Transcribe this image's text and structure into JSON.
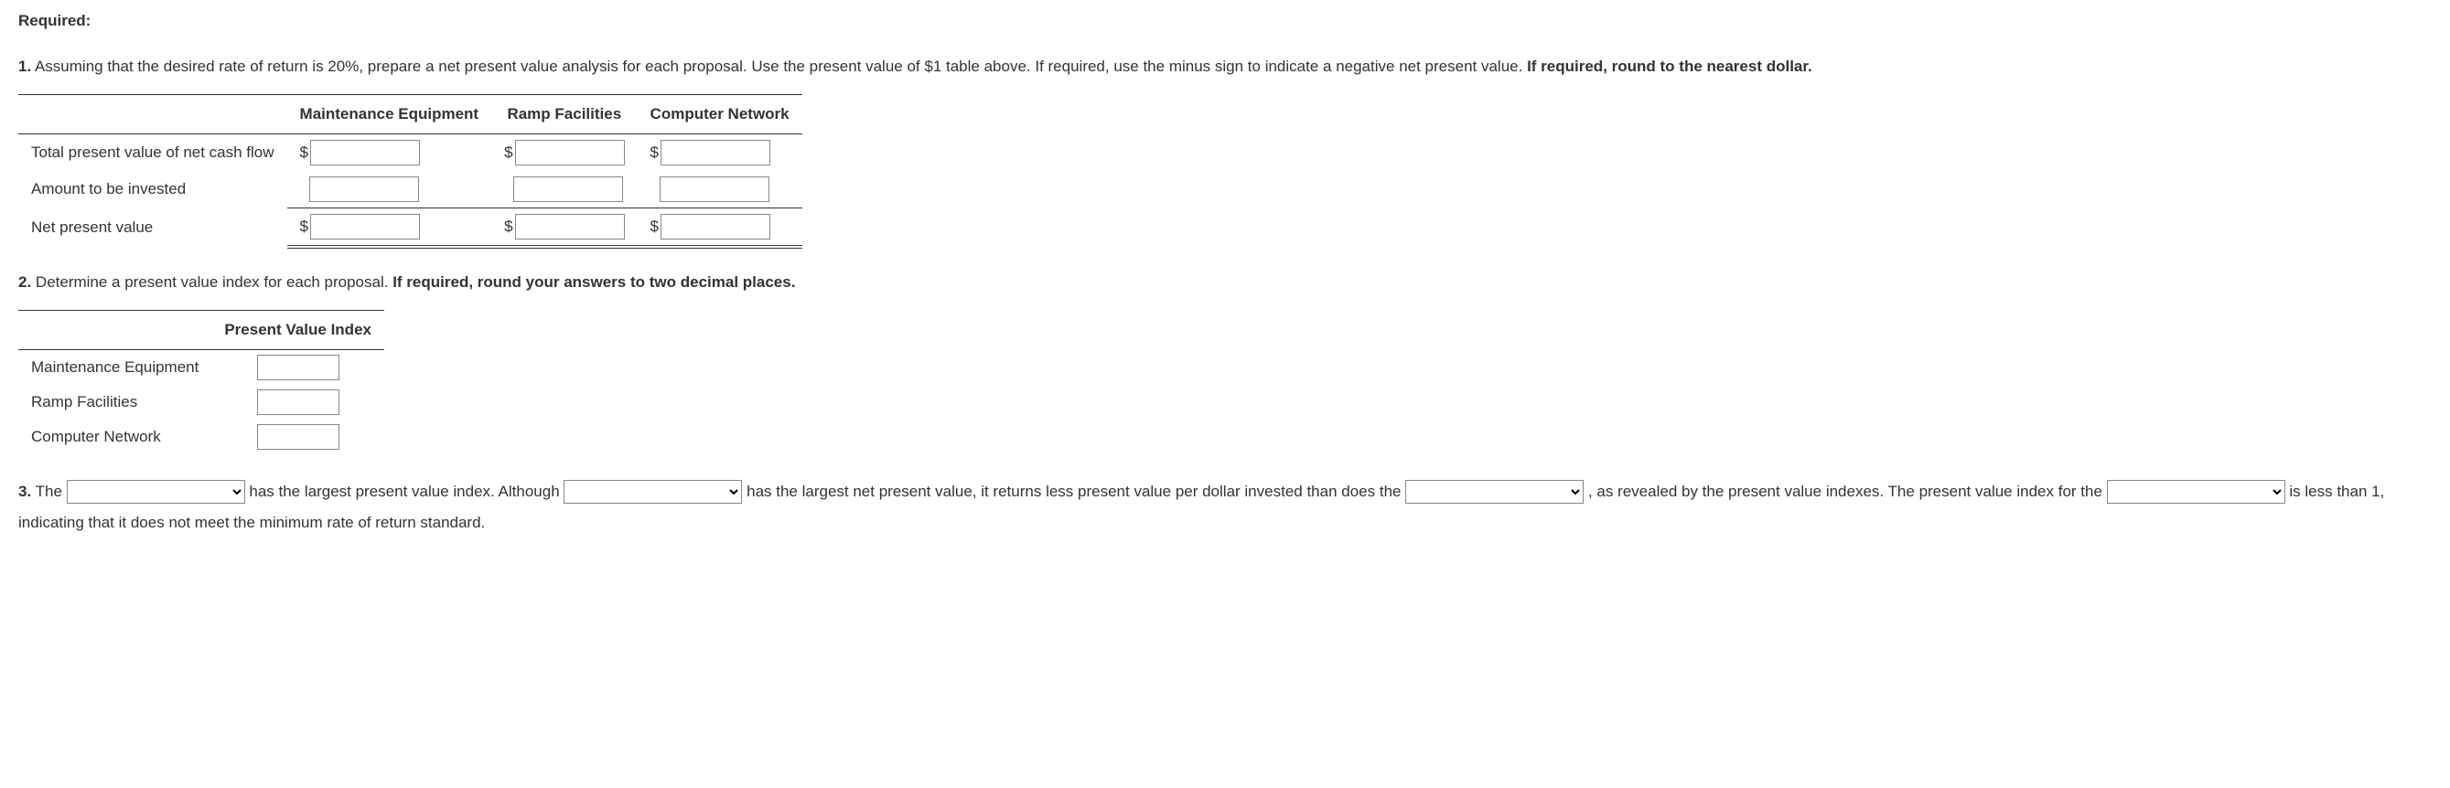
{
  "required_label": "Required:",
  "q1": {
    "number": "1.",
    "text_before_bold": " Assuming that the desired rate of return is 20%, prepare a net present value analysis for each proposal. Use the present value of $1 table above. If required, use the minus sign to indicate a negative net present value. ",
    "text_bold": "If required, round to the nearest dollar.",
    "table": {
      "col_headers": [
        "Maintenance Equipment",
        "Ramp Facilities",
        "Computer Network"
      ],
      "rows": [
        {
          "label": "Total present value of net cash flow",
          "dollar": true
        },
        {
          "label": "Amount to be invested",
          "dollar": false
        },
        {
          "label": "Net present value",
          "dollar": true
        }
      ]
    }
  },
  "q2": {
    "number": "2.",
    "text_before_bold": " Determine a present value index for each proposal. ",
    "text_bold": "If required, round your answers to two decimal places.",
    "table": {
      "header": "Present Value Index",
      "rows": [
        "Maintenance Equipment",
        "Ramp Facilities",
        "Computer Network"
      ]
    }
  },
  "q3": {
    "number": "3.",
    "part1": " The ",
    "part2": " has the largest present value index. Although ",
    "part3": " has the largest net present value, it returns less present value per dollar invested than does the ",
    "part4": " , as revealed by the present value indexes. The present value index for the ",
    "part5": " is less than 1, indicating that it does not meet the minimum rate of return standard."
  },
  "dollar_sign": "$"
}
